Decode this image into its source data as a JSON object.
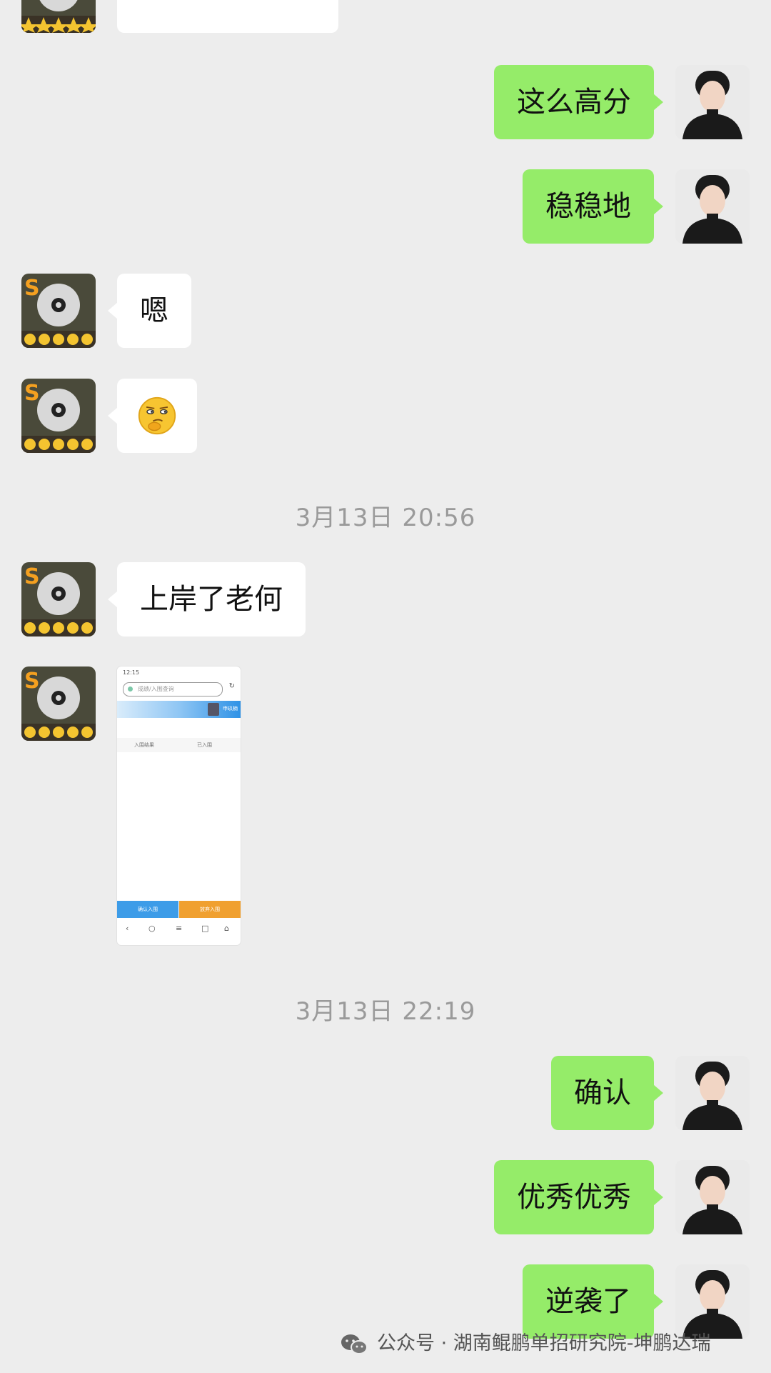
{
  "messages": [
    {
      "sender": "me",
      "text": "这么高分"
    },
    {
      "sender": "me",
      "text": "稳稳地"
    },
    {
      "sender": "them",
      "text": "嗯"
    },
    {
      "sender": "them",
      "type": "emoji",
      "emoji": "🤔"
    },
    {
      "type": "timestamp",
      "text": "3月13日 20:56"
    },
    {
      "sender": "them",
      "text": "上岸了老何"
    },
    {
      "sender": "them",
      "type": "image"
    },
    {
      "type": "timestamp",
      "text": "3月13日 22:19"
    },
    {
      "sender": "me",
      "text": "确认"
    },
    {
      "sender": "me",
      "text": "优秀优秀"
    },
    {
      "sender": "me",
      "text": "逆袭了"
    }
  ],
  "embedded_screenshot": {
    "status_time": "12:15",
    "search_placeholder": "成绩/入围查询",
    "user_label": "申玖楠",
    "tab_left": "入围结果",
    "tab_right": "已入围",
    "button_confirm": "确认入围",
    "button_abandon": "放弃入围"
  },
  "watermark": {
    "text": "公众号 · 湖南鲲鹏单招研究院-坤鹏达瑞"
  },
  "colors": {
    "background": "#ededed",
    "my_bubble": "#95ec69",
    "their_bubble": "#ffffff",
    "timestamp": "#9a9a9a"
  }
}
